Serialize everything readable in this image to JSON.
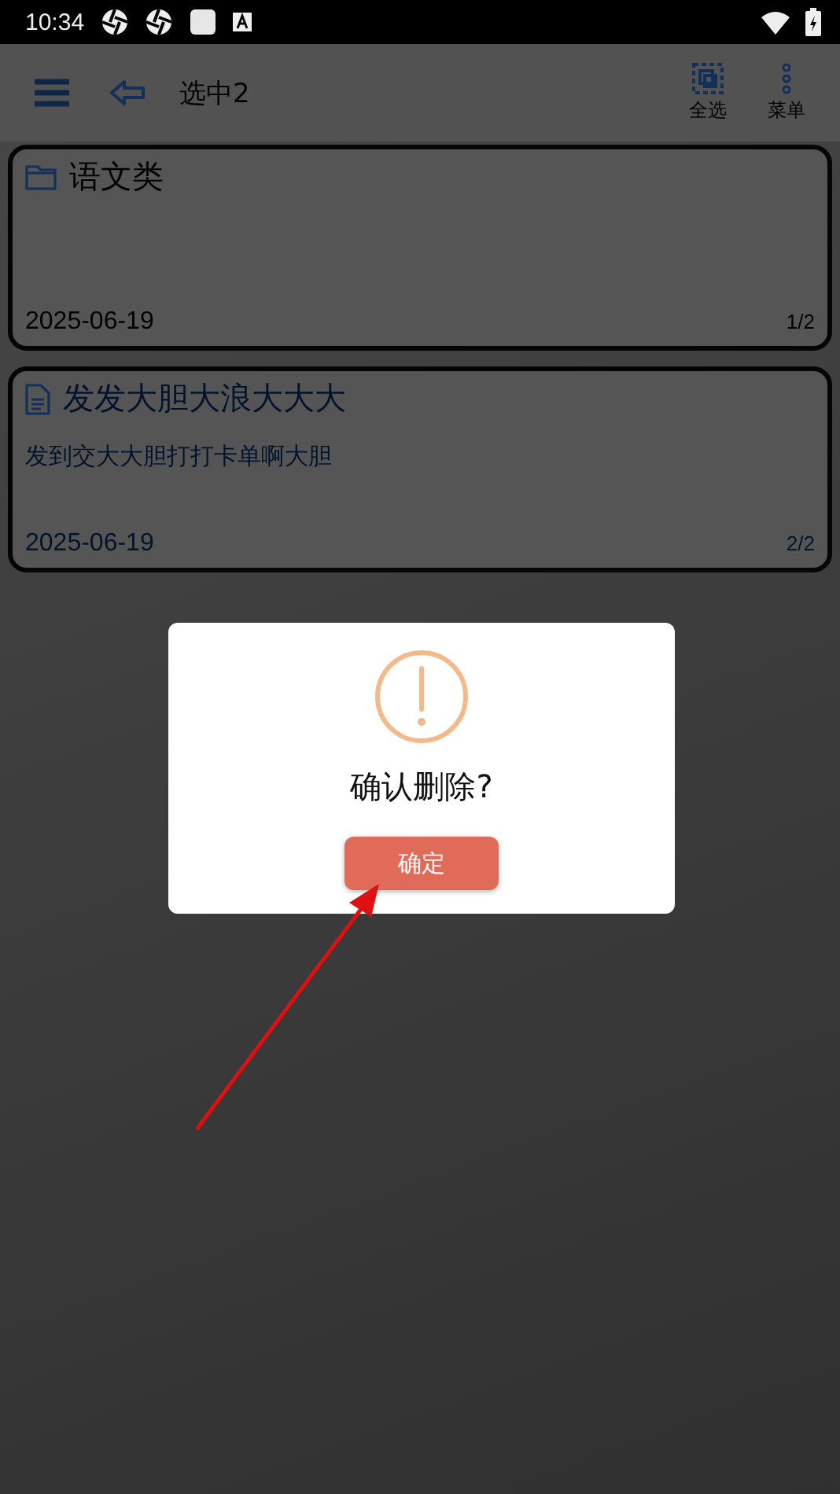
{
  "status_bar": {
    "time": "10:34"
  },
  "toolbar": {
    "title": "选中2",
    "actions": [
      {
        "kind": "select_all",
        "label": "全选"
      },
      {
        "kind": "more",
        "label": "菜单"
      }
    ]
  },
  "cards": [
    {
      "kind": "folder",
      "title": "语文类",
      "date": "2025-06-19",
      "position": "1/2"
    },
    {
      "kind": "note",
      "title": "发发大胆大浪大大大",
      "preview": "发到交大大胆打打卡单啊大胆",
      "date": "2025-06-19",
      "position": "2/2"
    }
  ],
  "dialog": {
    "message": "确认删除?",
    "button": "确定"
  }
}
